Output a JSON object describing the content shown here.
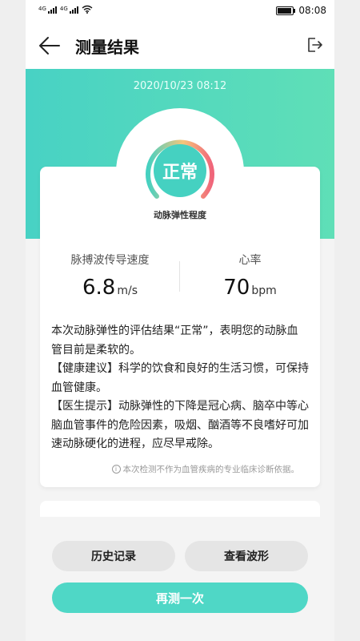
{
  "status_bar": {
    "signal_1": "4G",
    "signal_2": "4G",
    "wifi_icon": "wifi-icon",
    "battery_icon": "battery-icon",
    "battery_level": 0.95,
    "time": "08:08"
  },
  "header": {
    "back_icon": "arrow-left-icon",
    "title": "测量结果",
    "exit_icon": "exit-icon"
  },
  "hero": {
    "timestamp": "2020/10/23 08:12",
    "status": "正常",
    "gauge_label": "动脉弹性程度"
  },
  "metrics": [
    {
      "label": "脉搏波传导速度",
      "value": "6.8",
      "unit": "m/s"
    },
    {
      "label": "心率",
      "value": "70",
      "unit": "bpm"
    }
  ],
  "description": {
    "summary": "本次动脉弹性的评估结果“正常”，表明您的动脉血管目前是柔软的。",
    "advice": "【健康建议】科学的饮食和良好的生活习惯，可保持血管健康。",
    "tip": "【医生提示】动脉弹性的下降是冠心病、脑卒中等心脑血管事件的危险因素，吸烟、酗酒等不良嗜好可加速动脉硬化的进程，应尽早戒除。"
  },
  "disclaimer": "本次检测不作为血管疾病的专业临床诊断依据。",
  "buttons": {
    "history": "历史记录",
    "waveform": "查看波形",
    "remeasure": "再测一次"
  },
  "colors": {
    "accent": "#4fd7c6",
    "hero_start": "#48d2c4",
    "hero_end": "#5fdfb7",
    "gauge_good": "#45d1c1",
    "gauge_bad": "#f0657a",
    "gauge_mid": "#f7c57b"
  }
}
